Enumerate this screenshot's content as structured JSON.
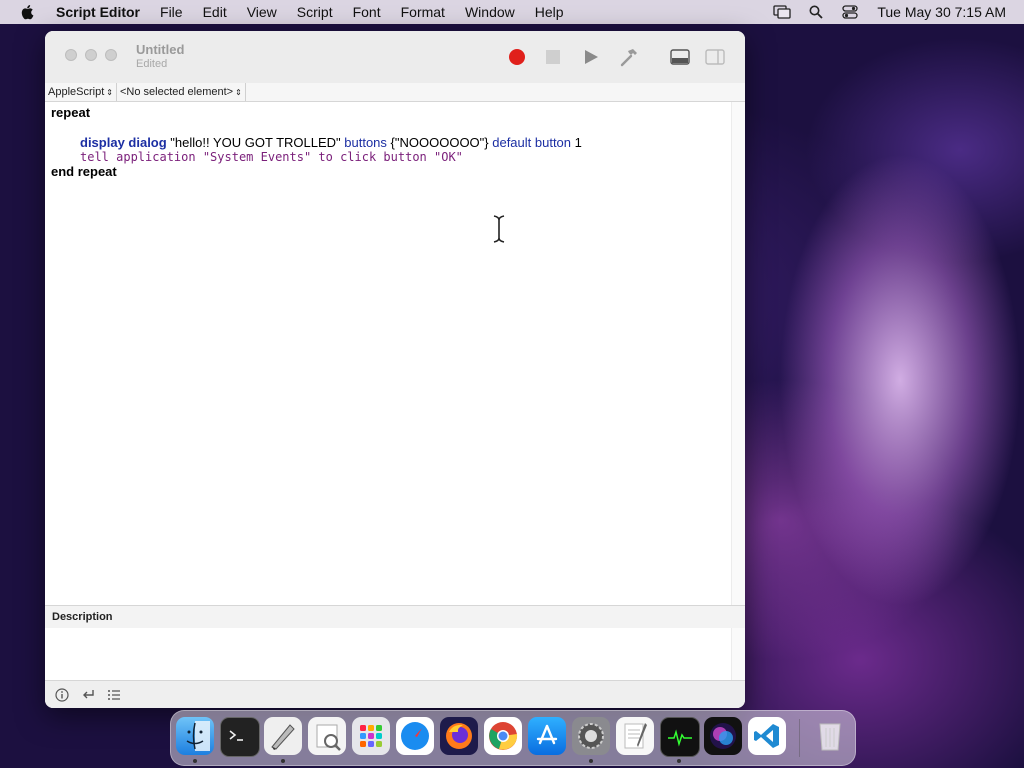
{
  "menubar": {
    "app_name": "Script Editor",
    "items": [
      "File",
      "Edit",
      "View",
      "Script",
      "Font",
      "Format",
      "Window",
      "Help"
    ],
    "clock": "Tue May 30  7:15 AM"
  },
  "window": {
    "title": "Untitled",
    "subtitle": "Edited",
    "language_selector": "AppleScript",
    "element_selector": "<No selected element>",
    "code": {
      "line1": "repeat",
      "line3_cmd": "display dialog",
      "line3_str1": " \"hello!! YOU GOT TROLLED\" ",
      "line3_p1": "buttons",
      "line3_str2": " {\"NOOOOOOO\"} ",
      "line3_p2": "default button",
      "line3_num": " 1",
      "line4": "tell application \"System Events\" to click button \"OK\"",
      "line5": "end repeat"
    },
    "description_label": "Description"
  },
  "dock": {
    "apps": [
      "Finder",
      "Terminal",
      "Script Editor",
      "Preview",
      "Launchpad",
      "Safari",
      "Firefox",
      "Chrome",
      "App Store",
      "System Preferences",
      "TextEdit",
      "Activity Monitor",
      "Siri",
      "Visual Studio Code",
      "Trash"
    ]
  },
  "colors": {
    "record": "#e0201b",
    "keyword_blue": "#1c2fa3",
    "tell_purple": "#7a1f7a"
  }
}
